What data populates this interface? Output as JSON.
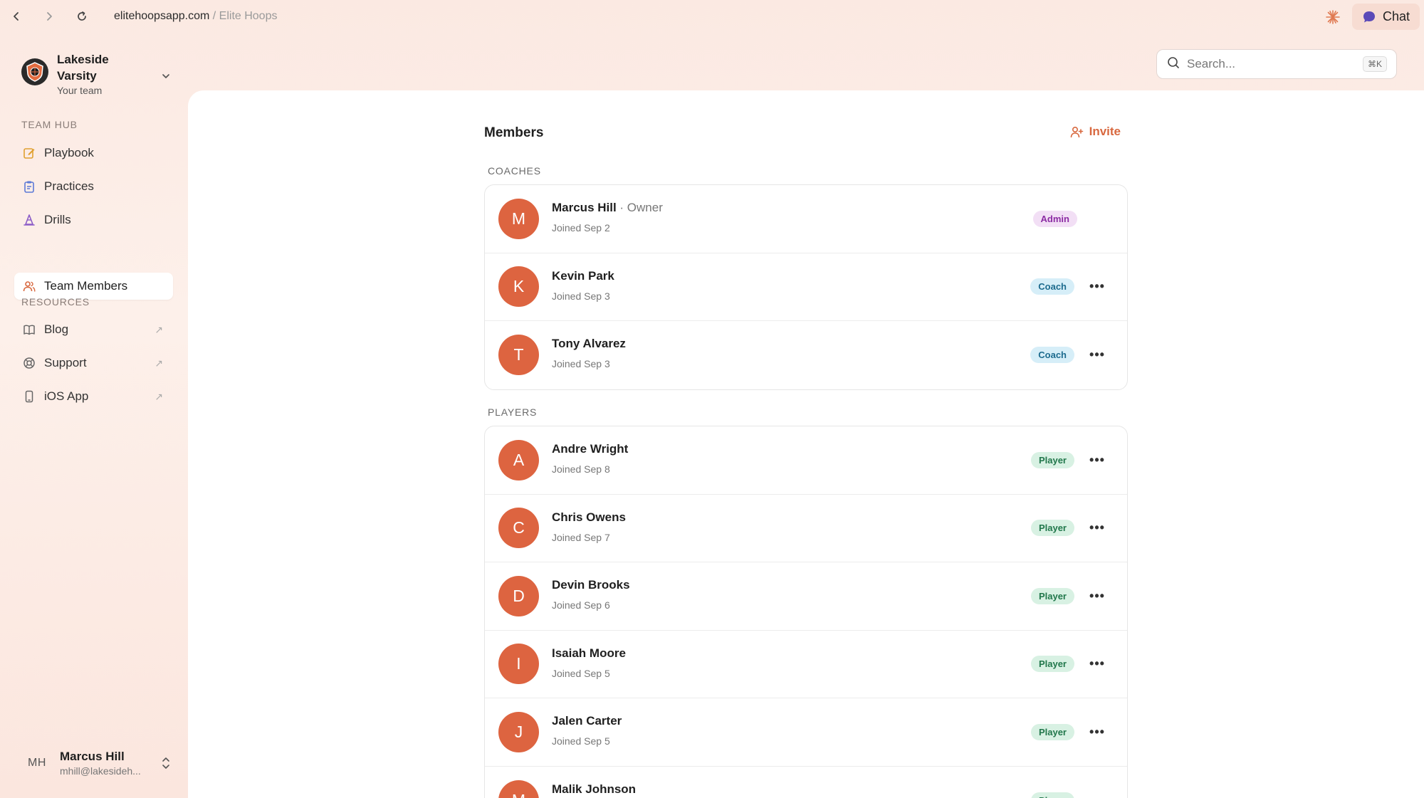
{
  "browser": {
    "domain": "elitehoopsapp.com",
    "separator": " / ",
    "page_title": "Elite Hoops",
    "chat_label": "Chat"
  },
  "sidebar": {
    "team": {
      "name": "Lakeside Varsity",
      "subtitle": "Your team"
    },
    "team_hub_label": "TEAM HUB",
    "team_hub_items": [
      {
        "label": "Playbook",
        "icon": "edit-icon"
      },
      {
        "label": "Practices",
        "icon": "clipboard-icon"
      },
      {
        "label": "Drills",
        "icon": "cone-icon"
      },
      {
        "label": "Team Members",
        "icon": "users-icon",
        "active": true
      }
    ],
    "resources_label": "RESOURCES",
    "resources_items": [
      {
        "label": "Blog",
        "icon": "book-icon",
        "external": "↗"
      },
      {
        "label": "Support",
        "icon": "lifebuoy-icon",
        "external": "↗"
      },
      {
        "label": "iOS App",
        "icon": "phone-icon",
        "external": "↗"
      }
    ],
    "user": {
      "initials": "MH",
      "name": "Marcus Hill",
      "email": "mhill@lakesideh..."
    }
  },
  "search": {
    "placeholder": "Search...",
    "shortcut": "⌘K"
  },
  "main": {
    "title": "Members",
    "invite_label": "Invite",
    "coaches_label": "COACHES",
    "players_label": "PLAYERS",
    "coaches": [
      {
        "initial": "M",
        "name": "Marcus Hill",
        "suffix": " · Owner",
        "joined": "Joined Sep 2",
        "role": "Admin"
      },
      {
        "initial": "K",
        "name": "Kevin Park",
        "suffix": "",
        "joined": "Joined Sep 3",
        "role": "Coach"
      },
      {
        "initial": "T",
        "name": "Tony Alvarez",
        "suffix": "",
        "joined": "Joined Sep 3",
        "role": "Coach"
      }
    ],
    "players": [
      {
        "initial": "A",
        "name": "Andre Wright",
        "joined": "Joined Sep 8",
        "role": "Player"
      },
      {
        "initial": "C",
        "name": "Chris Owens",
        "joined": "Joined Sep 7",
        "role": "Player"
      },
      {
        "initial": "D",
        "name": "Devin Brooks",
        "joined": "Joined Sep 6",
        "role": "Player"
      },
      {
        "initial": "I",
        "name": "Isaiah Moore",
        "joined": "Joined Sep 5",
        "role": "Player"
      },
      {
        "initial": "J",
        "name": "Jalen Carter",
        "joined": "Joined Sep 5",
        "role": "Player"
      },
      {
        "initial": "M",
        "name": "Malik Johnson",
        "joined": "",
        "role": "Player"
      }
    ]
  },
  "colors": {
    "accent": "#dd6440",
    "invite": "#d8683f"
  }
}
